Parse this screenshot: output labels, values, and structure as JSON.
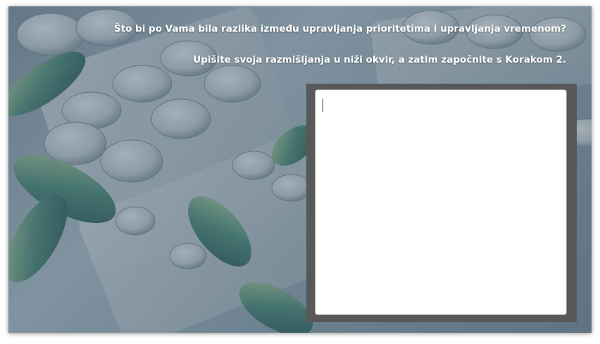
{
  "prompt": {
    "question": "Što bi po Vama bila razlika između upravljanja prioritetima i upravljanja vremenom?",
    "instruction": "Upišite svoja razmišljanja u niži okvir, a zatim započnite s Korakom 2."
  },
  "answer_box": {
    "value": "",
    "placeholder": ""
  },
  "background": {
    "image": "medicine-pills-blister-packs"
  },
  "colors": {
    "frame": "#585858",
    "overlay": "#284054",
    "text": "#ffffff"
  }
}
